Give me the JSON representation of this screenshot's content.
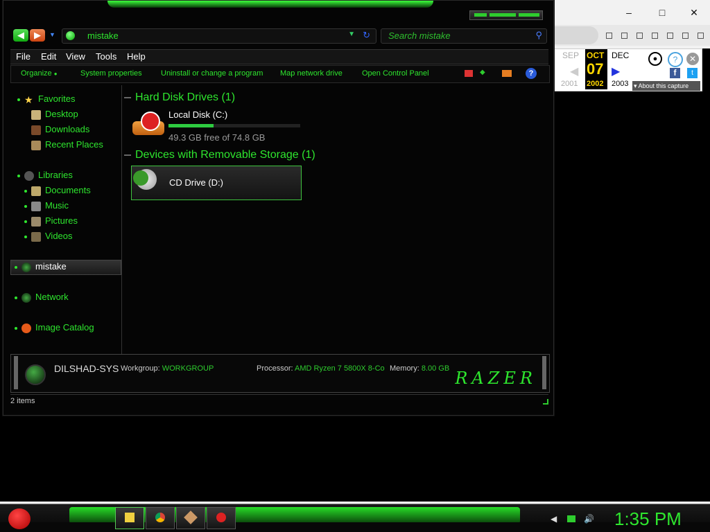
{
  "browser": {
    "window_controls": [
      "–",
      "□",
      "✕"
    ],
    "wayback": {
      "months": [
        "SEP",
        "OCT",
        "DEC"
      ],
      "day": "07",
      "years": [
        "2001",
        "2002",
        "2003"
      ],
      "about": "About this capture"
    }
  },
  "explorer": {
    "address": "mistake",
    "search_placeholder": "Search mistake",
    "menu": [
      "File",
      "Edit",
      "View",
      "Tools",
      "Help"
    ],
    "commands": [
      "Organize",
      "System properties",
      "Uninstall or change a program",
      "Map network drive",
      "Open Control Panel"
    ],
    "nav": {
      "favorites": "Favorites",
      "favorites_items": [
        "Desktop",
        "Downloads",
        "Recent Places"
      ],
      "libraries": "Libraries",
      "libraries_items": [
        "Documents",
        "Music",
        "Pictures",
        "Videos"
      ],
      "computer": "mistake",
      "network": "Network",
      "image_catalog": "Image Catalog"
    },
    "groups": {
      "hdd": "Hard Disk Drives (1)",
      "removable": "Devices with Removable Storage (1)"
    },
    "drives": {
      "c_name": "Local Disk (C:)",
      "c_free": "49.3 GB free of 74.8 GB",
      "c_used_fraction": 0.34,
      "d_name": "CD Drive (D:)"
    },
    "details": {
      "computer_name": "DILSHAD-SYS",
      "workgroup_label": "Workgroup:",
      "workgroup": "WORKGROUP",
      "processor_label": "Processor:",
      "processor": "AMD Ryzen 7 5800X 8-Co",
      "memory_label": "Memory:",
      "memory": "8.00 GB",
      "logo": "RAZER"
    },
    "status": "2 items"
  },
  "taskbar": {
    "clock": "1:35 PM"
  },
  "colors": {
    "accent": "#2ee62e",
    "background": "#000000"
  }
}
